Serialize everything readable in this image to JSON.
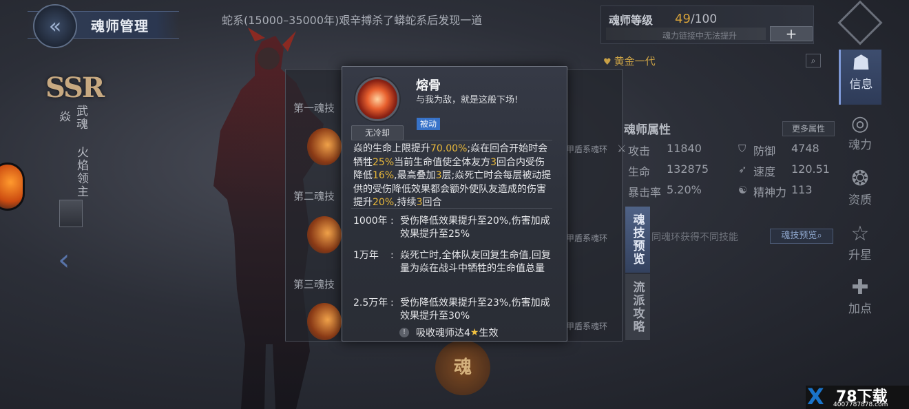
{
  "header": {
    "page_title": "魂师管理",
    "news_ticker": "蛇系(15000–35000年)艰辛搏杀了蟒蛇系后发现一道"
  },
  "level_panel": {
    "label": "魂师等级",
    "current": "49",
    "max": "/100",
    "hint": "魂力链接中无法提升",
    "add_label": "+"
  },
  "generation": {
    "label": "黄金一代",
    "icon": "heart-icon"
  },
  "character": {
    "rarity": "SSR",
    "name": "焱",
    "spirit_label": "武魂",
    "spirit_name": "火焰领主"
  },
  "nav": {
    "items": [
      {
        "label": "信息",
        "icon": "mask-icon"
      },
      {
        "label": "魂力",
        "icon": "swirl-icon"
      },
      {
        "label": "资质",
        "icon": "emblem-icon"
      },
      {
        "label": "升星",
        "icon": "star-icon"
      },
      {
        "label": "加点",
        "icon": "plus-cross-icon"
      }
    ]
  },
  "attributes": {
    "title": "魂师属性",
    "more_label": "更多属性",
    "stats": [
      {
        "label": "攻击",
        "value": "11840"
      },
      {
        "label": "防御",
        "value": "4748"
      },
      {
        "label": "生命",
        "value": "132875"
      },
      {
        "label": "速度",
        "value": "120.51"
      },
      {
        "label": "暴击率",
        "value": "5.20%"
      },
      {
        "label": "精神力",
        "value": "113"
      }
    ]
  },
  "skills": {
    "slots": [
      {
        "label": "第一魂技",
        "ring": "甲盾系魂环"
      },
      {
        "label": "第二魂技",
        "ring": "甲盾系魂环"
      },
      {
        "label": "第三魂技",
        "ring": "甲盾系魂环"
      }
    ],
    "note": "同魂环获得不同技能",
    "preview_button": "魂技预览",
    "wuhun_emblem": "魂"
  },
  "side_tabs": {
    "skill_preview": "魂技预览",
    "strategy": "流派攻略"
  },
  "tooltip": {
    "name": "熔骨",
    "quote": "与我为敌，就是这般下场!",
    "cooldown": "无冷却",
    "tag": "被动",
    "description_parts": [
      {
        "t": "焱的生命上限提升",
        "h": false
      },
      {
        "t": "70.00%",
        "h": true
      },
      {
        "t": ";焱在回合开始时会牺牲",
        "h": false
      },
      {
        "t": "25%",
        "h": true
      },
      {
        "t": "当前生命值使全体友方",
        "h": false
      },
      {
        "t": "3",
        "h": true
      },
      {
        "t": "回合内受伤降低",
        "h": false
      },
      {
        "t": "16%",
        "h": true
      },
      {
        "t": ",最高叠加",
        "h": false
      },
      {
        "t": "3",
        "h": true
      },
      {
        "t": "层;焱死亡时会每层被动提供的受伤降低效果都会额外使队友造成的伤害提升",
        "h": false
      },
      {
        "t": "20%",
        "h": true
      },
      {
        "t": ",持续",
        "h": false
      },
      {
        "t": "3",
        "h": true
      },
      {
        "t": "回合",
        "h": false
      }
    ],
    "upgrades": [
      {
        "label": "1000年",
        "text": "受伤降低效果提升至20%,伤害加成效果提升至25%"
      },
      {
        "label": "1万年",
        "text": "焱死亡时,全体队友回复生命值,回复量为焱在战斗中牺牲的生命值总量"
      },
      {
        "label": "2.5万年",
        "text": "受伤降低效果提升至23%,伤害加成效果提升至30%"
      }
    ],
    "colon": ":",
    "requirement_prefix": "吸收魂师达4",
    "requirement_suffix": "生效",
    "requirement_icon": "!"
  },
  "watermark": {
    "logo": "X",
    "title": "78下载",
    "url": "4007787878.com"
  },
  "colors": {
    "highlight": "#e8b83a",
    "passive_tag": "#3873c9",
    "nav_active": "#3d4d6e"
  }
}
